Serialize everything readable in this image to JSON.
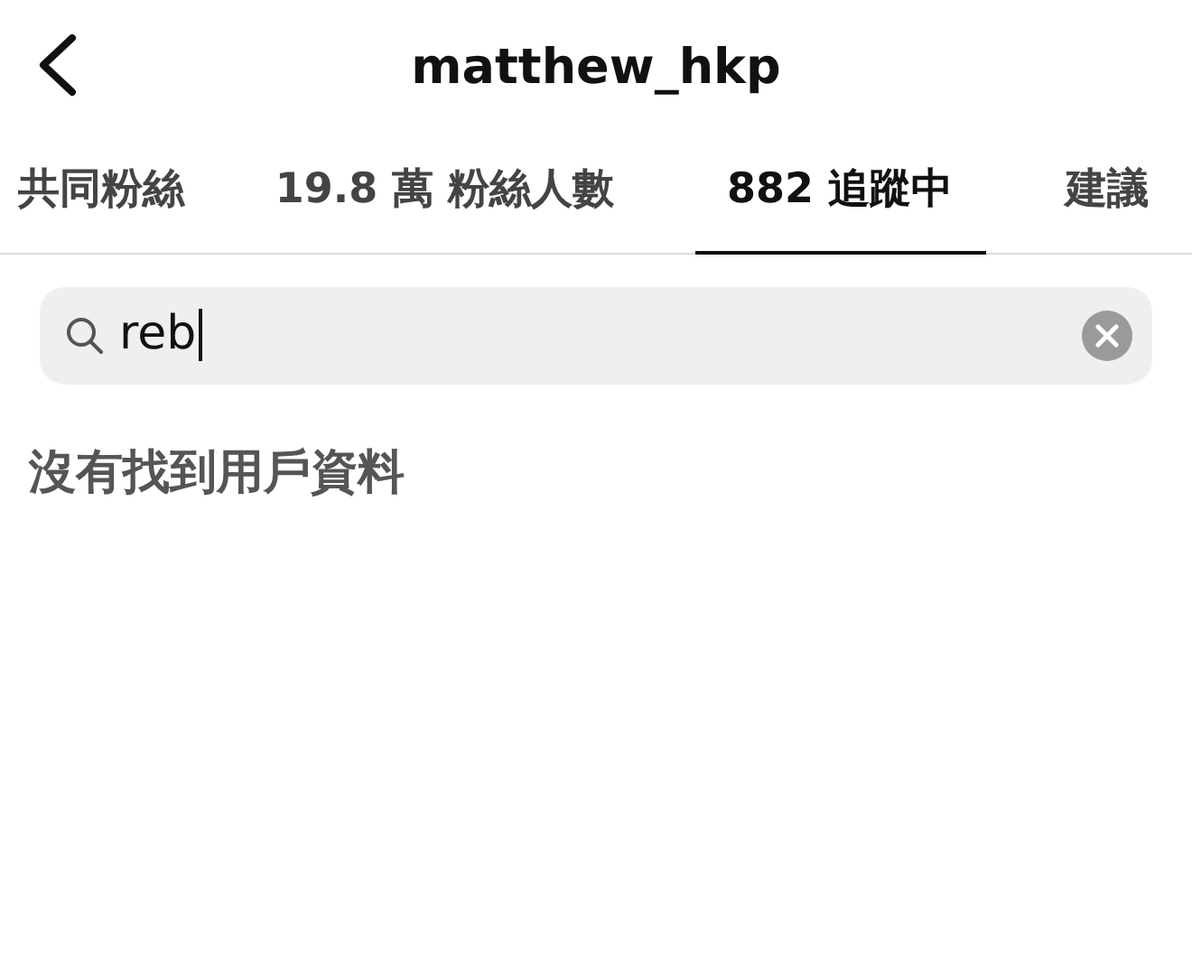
{
  "header": {
    "title": "matthew_hkp"
  },
  "tabs": [
    {
      "label": "共同粉絲",
      "selected": false
    },
    {
      "label": "19.8 萬 粉絲人數",
      "selected": false
    },
    {
      "label": "882 追蹤中",
      "selected": true
    },
    {
      "label": "建議",
      "selected": false
    }
  ],
  "search": {
    "value": "reb"
  },
  "message": "沒有找到用戶資料"
}
